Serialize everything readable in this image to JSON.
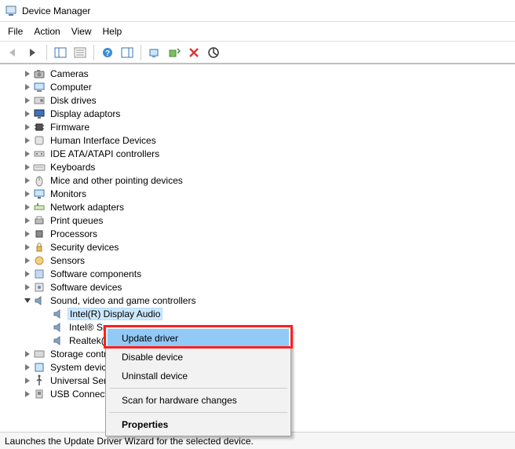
{
  "window": {
    "title": "Device Manager"
  },
  "menus": {
    "file": "File",
    "action": "Action",
    "view": "View",
    "help": "Help"
  },
  "tree": {
    "categories": [
      {
        "label": "Cameras",
        "icon": "camera"
      },
      {
        "label": "Computer",
        "icon": "computer"
      },
      {
        "label": "Disk drives",
        "icon": "disk"
      },
      {
        "label": "Display adaptors",
        "icon": "display"
      },
      {
        "label": "Firmware",
        "icon": "chip"
      },
      {
        "label": "Human Interface Devices",
        "icon": "hid"
      },
      {
        "label": "IDE ATA/ATAPI controllers",
        "icon": "ide"
      },
      {
        "label": "Keyboards",
        "icon": "keyboard"
      },
      {
        "label": "Mice and other pointing devices",
        "icon": "mouse"
      },
      {
        "label": "Monitors",
        "icon": "monitor"
      },
      {
        "label": "Network adapters",
        "icon": "network"
      },
      {
        "label": "Print queues",
        "icon": "printer"
      },
      {
        "label": "Processors",
        "icon": "cpu"
      },
      {
        "label": "Security devices",
        "icon": "security"
      },
      {
        "label": "Sensors",
        "icon": "sensor"
      },
      {
        "label": "Software components",
        "icon": "component"
      },
      {
        "label": "Software devices",
        "icon": "softdev"
      }
    ],
    "sound_category": "Sound, video and game controllers",
    "sound_children": [
      {
        "label": "Intel(R) Display Audio"
      },
      {
        "label": "Intel® Sm"
      },
      {
        "label": "Realtek(R)"
      }
    ],
    "after_categories": [
      {
        "label": "Storage contr",
        "icon": "storage"
      },
      {
        "label": "System device",
        "icon": "system"
      },
      {
        "label": "Universal Seri",
        "icon": "usb"
      },
      {
        "label": "USB Connecto",
        "icon": "usbconn"
      }
    ]
  },
  "context_menu": {
    "items": [
      {
        "label": "Update driver",
        "highlight": true
      },
      {
        "label": "Disable device"
      },
      {
        "label": "Uninstall device"
      },
      {
        "sep": true
      },
      {
        "label": "Scan for hardware changes"
      },
      {
        "sep": true
      },
      {
        "label": "Properties",
        "bold": true
      }
    ]
  },
  "statusbar": {
    "text": "Launches the Update Driver Wizard for the selected device."
  }
}
